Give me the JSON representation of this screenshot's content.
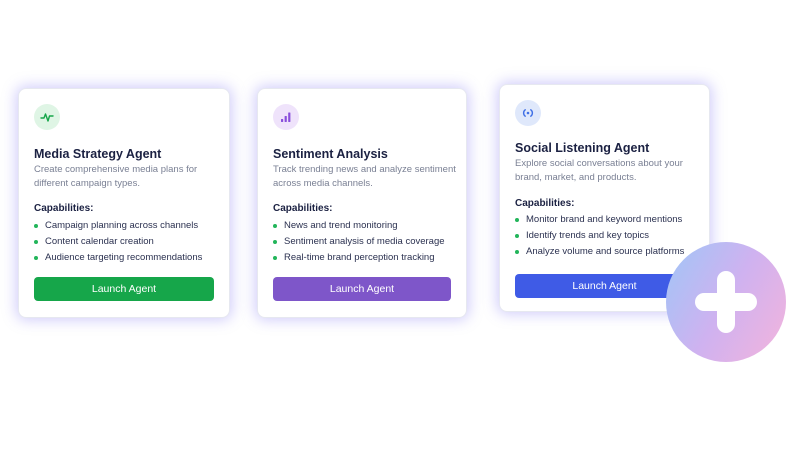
{
  "colors": {
    "green": "#16a64a",
    "purple": "#7e56c9",
    "blue": "#3f5be6",
    "bullet": "#22b55a"
  },
  "cards": [
    {
      "icon": "activity-pulse-icon",
      "title": "Media Strategy Agent",
      "description": "Create comprehensive media plans for different campaign types.",
      "capabilities_title": "Capabilities:",
      "capabilities": [
        "Campaign planning across channels",
        "Content calendar creation",
        "Audience targeting recommendations"
      ],
      "button": "Launch Agent"
    },
    {
      "icon": "bar-chart-icon",
      "title": "Sentiment Analysis",
      "description": "Track trending news and analyze sentiment across media channels.",
      "capabilities_title": "Capabilities:",
      "capabilities": [
        "News and trend monitoring",
        "Sentiment analysis of media coverage",
        "Real-time brand perception tracking"
      ],
      "button": "Launch Agent"
    },
    {
      "icon": "broadcast-signal-icon",
      "title": "Social Listening Agent",
      "description": "Explore social conversations about your brand, market, and products.",
      "capabilities_title": "Capabilities:",
      "capabilities": [
        "Monitor brand and keyword mentions",
        "Identify trends and key topics",
        "Analyze volume and source platforms"
      ],
      "button": "Launch Agent"
    }
  ],
  "fab": {
    "icon": "plus-icon"
  }
}
